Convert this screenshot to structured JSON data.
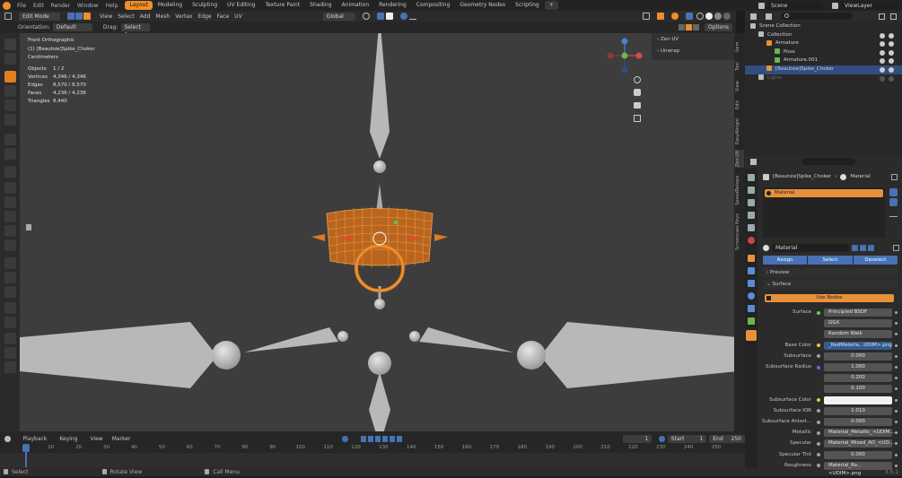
{
  "topbar": {
    "menus": [
      "File",
      "Edit",
      "Render",
      "Window",
      "Help"
    ],
    "workspaces": [
      "Layout",
      "Modeling",
      "Sculpting",
      "UV Editing",
      "Texture Paint",
      "Shading",
      "Animation",
      "Rendering",
      "Compositing",
      "Geometry Nodes",
      "Scripting"
    ],
    "add_tab": "+",
    "scene": "Scene",
    "view_layer": "ViewLayer"
  },
  "header": {
    "mode": "Edit Mode",
    "menus": [
      "View",
      "Select",
      "Add",
      "Mesh",
      "Vertex",
      "Edge",
      "Face",
      "UV"
    ],
    "transform": "Global"
  },
  "header2": {
    "orientation_label": "Orientation:",
    "orientation": "Default",
    "drag_label": "Drag:",
    "drag": "Select Box",
    "options": "Options"
  },
  "overlay": {
    "view": "Front Orthographic",
    "object": "(1) [Beautsie]Spike_Choker",
    "units": "Centimeters",
    "stats": [
      {
        "k": "Objects",
        "v": "1 / 2"
      },
      {
        "k": "Vertices",
        "v": "4,346 / 4,346"
      },
      {
        "k": "Edges",
        "v": "8,570 / 8,570"
      },
      {
        "k": "Faces",
        "v": "4,236 / 4,236"
      },
      {
        "k": "Triangles",
        "v": "8,440"
      }
    ]
  },
  "npanel": {
    "items": [
      "Zen UV",
      "Unwrap"
    ]
  },
  "sidetabs": [
    "Item",
    "Tool",
    "View",
    "Edit",
    "EasyWeight",
    "Zen UV",
    "SpeedRetopo",
    "Screencast Keys"
  ],
  "timeline": {
    "menus": [
      "Playback",
      "Keying",
      "View",
      "Marker"
    ],
    "current": "1",
    "start_label": "Start",
    "start": "1",
    "end_label": "End",
    "end": "250",
    "ticks": [
      "1",
      "10",
      "20",
      "30",
      "40",
      "50",
      "60",
      "70",
      "80",
      "90",
      "100",
      "110",
      "120",
      "130",
      "140",
      "150",
      "160",
      "170",
      "180",
      "190",
      "200",
      "210",
      "220",
      "230",
      "240",
      "250"
    ]
  },
  "status": {
    "select": "Select",
    "rotate": "Rotate View",
    "menu": "Call Menu",
    "version": "3.5.1"
  },
  "outliner": {
    "items": [
      {
        "label": "Scene Collection",
        "indent": 0
      },
      {
        "label": "Collection",
        "indent": 1
      },
      {
        "label": "Armature",
        "indent": 2
      },
      {
        "label": "Pose",
        "indent": 3
      },
      {
        "label": "Armature.001",
        "indent": 3
      },
      {
        "label": "[Beautsie]Spike_Choker",
        "indent": 2,
        "selected": true
      },
      {
        "label": "Lights",
        "indent": 1,
        "dim": true
      }
    ]
  },
  "props": {
    "breadcrumb_object": "[Beautsie]Spike_Choker",
    "breadcrumb_material": "Material",
    "slot": "Material",
    "material_name": "Material",
    "assign": "Assign",
    "select": "Select",
    "deselect": "Deselect",
    "preview": "Preview",
    "surface_section": "Surface",
    "use_nodes": "Use Nodes",
    "fields": [
      {
        "label": "Surface",
        "value": "Principled BSDF",
        "dot": "#6dc85a"
      },
      {
        "label": "",
        "value": "GGX"
      },
      {
        "label": "",
        "value": "Random Walk"
      },
      {
        "label": "Base Color",
        "value": "_RedMateria...UDIM>.png",
        "dot": "#e6c24a",
        "blue": true
      },
      {
        "label": "Subsurface",
        "value": "0.000",
        "dot": "#a0a0a0"
      },
      {
        "label": "Subsurface Radius",
        "value": "1.000",
        "dot": "#6a6ae6"
      },
      {
        "label": "",
        "value": "0.200"
      },
      {
        "label": "",
        "value": "0.100"
      },
      {
        "label": "Subsurface Color",
        "value": "",
        "dot": "#e6c24a",
        "white": true
      },
      {
        "label": "Subsurface IOR",
        "value": "1.010",
        "dot": "#a0a0a0"
      },
      {
        "label": "Subsurface Anisot...",
        "value": "0.000",
        "dot": "#a0a0a0"
      },
      {
        "label": "Metallic",
        "value": "Material_Metallic_<UDIM...",
        "dot": "#a0a0a0"
      },
      {
        "label": "Specular",
        "value": "Material_Mixed_AO_<UD...",
        "dot": "#a0a0a0"
      },
      {
        "label": "Specular Tint",
        "value": "0.000",
        "dot": "#a0a0a0"
      },
      {
        "label": "Roughness",
        "value": "Material_Ro...<UDIM>.png",
        "dot": "#a0a0a0"
      }
    ]
  },
  "colors": {
    "accent": "#ef8e2a",
    "selected_row": "#334d80",
    "viewport": "#3d3d3d"
  }
}
